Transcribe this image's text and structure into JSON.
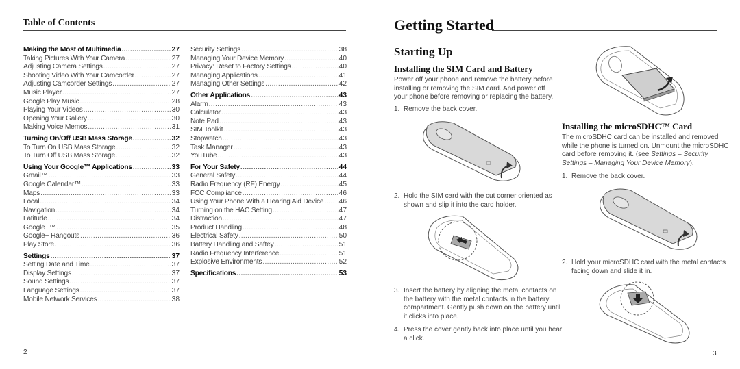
{
  "left_page": {
    "toc_title": "Table of Contents",
    "page_number": "2",
    "column1": [
      {
        "label": "Making the Most of Multimedia",
        "page": "27",
        "heading": true
      },
      {
        "label": "Taking Pictures With Your Camera",
        "page": "27"
      },
      {
        "label": "Adjusting Camera Settings",
        "page": "27"
      },
      {
        "label": "Shooting Video With Your Camcorder",
        "page": "27"
      },
      {
        "label": "Adjusting Camcorder Settings",
        "page": "27"
      },
      {
        "label": "Music Player",
        "page": "27"
      },
      {
        "label": "Google Play Music",
        "page": "28"
      },
      {
        "label": "Playing Your Videos",
        "page": "30"
      },
      {
        "label": "Opening Your Gallery",
        "page": "30"
      },
      {
        "label": "Making Voice Memos",
        "page": "31"
      },
      {
        "label": "Turning On/Off USB Mass Storage",
        "page": "32",
        "heading": true
      },
      {
        "label": "To Turn On USB Mass Storage",
        "page": "32"
      },
      {
        "label": "To Turn Off USB Mass Storage",
        "page": "32"
      },
      {
        "label": "Using Your Google™ Applications",
        "page": "33",
        "heading": true
      },
      {
        "label": "Gmail™",
        "page": "33"
      },
      {
        "label": "Google Calendar™",
        "page": "33"
      },
      {
        "label": "Maps",
        "page": "33"
      },
      {
        "label": "Local",
        "page": "34"
      },
      {
        "label": "Navigation",
        "page": "34"
      },
      {
        "label": "Latitude",
        "page": "34"
      },
      {
        "label": "Google+™",
        "page": "35"
      },
      {
        "label": "Google+ Hangouts",
        "page": "36"
      },
      {
        "label": "Play Store",
        "page": "36"
      },
      {
        "label": "Settings",
        "page": "37",
        "heading": true
      },
      {
        "label": "Setting Date and Time",
        "page": "37"
      },
      {
        "label": "Display Settings",
        "page": "37"
      },
      {
        "label": "Sound Settings",
        "page": "37"
      },
      {
        "label": "Language Settings",
        "page": "37"
      },
      {
        "label": "Mobile Network Services",
        "page": "38"
      }
    ],
    "column2": [
      {
        "label": "Security Settings",
        "page": "38"
      },
      {
        "label": "Managing Your Device Memory",
        "page": "40"
      },
      {
        "label": "Privacy: Reset to Factory Settings",
        "page": "40"
      },
      {
        "label": "Managing Applications",
        "page": "41"
      },
      {
        "label": "Managing Other Settings",
        "page": "42"
      },
      {
        "label": "Other Applications",
        "page": "43",
        "heading": true
      },
      {
        "label": "Alarm",
        "page": "43"
      },
      {
        "label": "Calculator",
        "page": "43"
      },
      {
        "label": "Note Pad",
        "page": "43"
      },
      {
        "label": "SIM Toolkit",
        "page": "43"
      },
      {
        "label": "Stopwatch",
        "page": "43"
      },
      {
        "label": "Task Manager",
        "page": "43"
      },
      {
        "label": "YouTube",
        "page": "43"
      },
      {
        "label": "For Your Safety",
        "page": "44",
        "heading": true
      },
      {
        "label": "General Safety",
        "page": "44"
      },
      {
        "label": "Radio Frequency (RF) Energy",
        "page": "45"
      },
      {
        "label": "FCC Compliance",
        "page": "46"
      },
      {
        "label": "Using Your Phone With a Hearing Aid Device",
        "page": "46"
      },
      {
        "label": "Turning on the HAC Setting",
        "page": "47"
      },
      {
        "label": "Distraction",
        "page": "47"
      },
      {
        "label": "Product Handling",
        "page": "48"
      },
      {
        "label": "Electrical Safety",
        "page": "50"
      },
      {
        "label": "Battery Handling and Saftey",
        "page": "51"
      },
      {
        "label": "Radio Frequency Interference",
        "page": "51"
      },
      {
        "label": "Explosive Environments",
        "page": "52"
      },
      {
        "label": "Specifications",
        "page": "53",
        "heading": true
      }
    ]
  },
  "right_page": {
    "chapter_title": "Getting Started",
    "section_title": "Starting Up",
    "page_number": "3",
    "sim": {
      "heading": "Installing the SIM Card and Battery",
      "intro": "Power off your phone and remove the battery before installing or removing the SIM card. And power off your phone before removing or replacing the battery.",
      "steps": [
        {
          "n": "1.",
          "text": "Remove the back cover."
        },
        {
          "n": "2.",
          "text": "Hold the SIM card with the cut corner oriented as shown and slip it into the card holder."
        },
        {
          "n": "3.",
          "text": "Insert the battery by aligning the metal contacts on the battery with the metal contacts in the battery compartment. Gently push down on the battery until it clicks into place."
        },
        {
          "n": "4.",
          "text": "Press the cover gently back into place until you hear a click."
        }
      ]
    },
    "sd": {
      "heading": "Installing the microSDHC™ Card",
      "intro_plain": "The microSDHC card can be installed and removed while the phone is turned on. Unmount the microSDHC card before removing it. (see ",
      "intro_italic": "Settings – Security Settings – Managing Your Device Memory",
      "intro_end": ").",
      "steps": [
        {
          "n": "1.",
          "text": "Remove the back cover."
        },
        {
          "n": "2.",
          "text": "Hold your microSDHC card with the metal contacts facing down and slide it in."
        }
      ]
    },
    "figures": [
      {
        "name": "remove-back-cover"
      },
      {
        "name": "insert-sim-card"
      },
      {
        "name": "insert-battery"
      },
      {
        "name": "remove-back-cover-sd"
      },
      {
        "name": "insert-microsd-card"
      }
    ]
  }
}
